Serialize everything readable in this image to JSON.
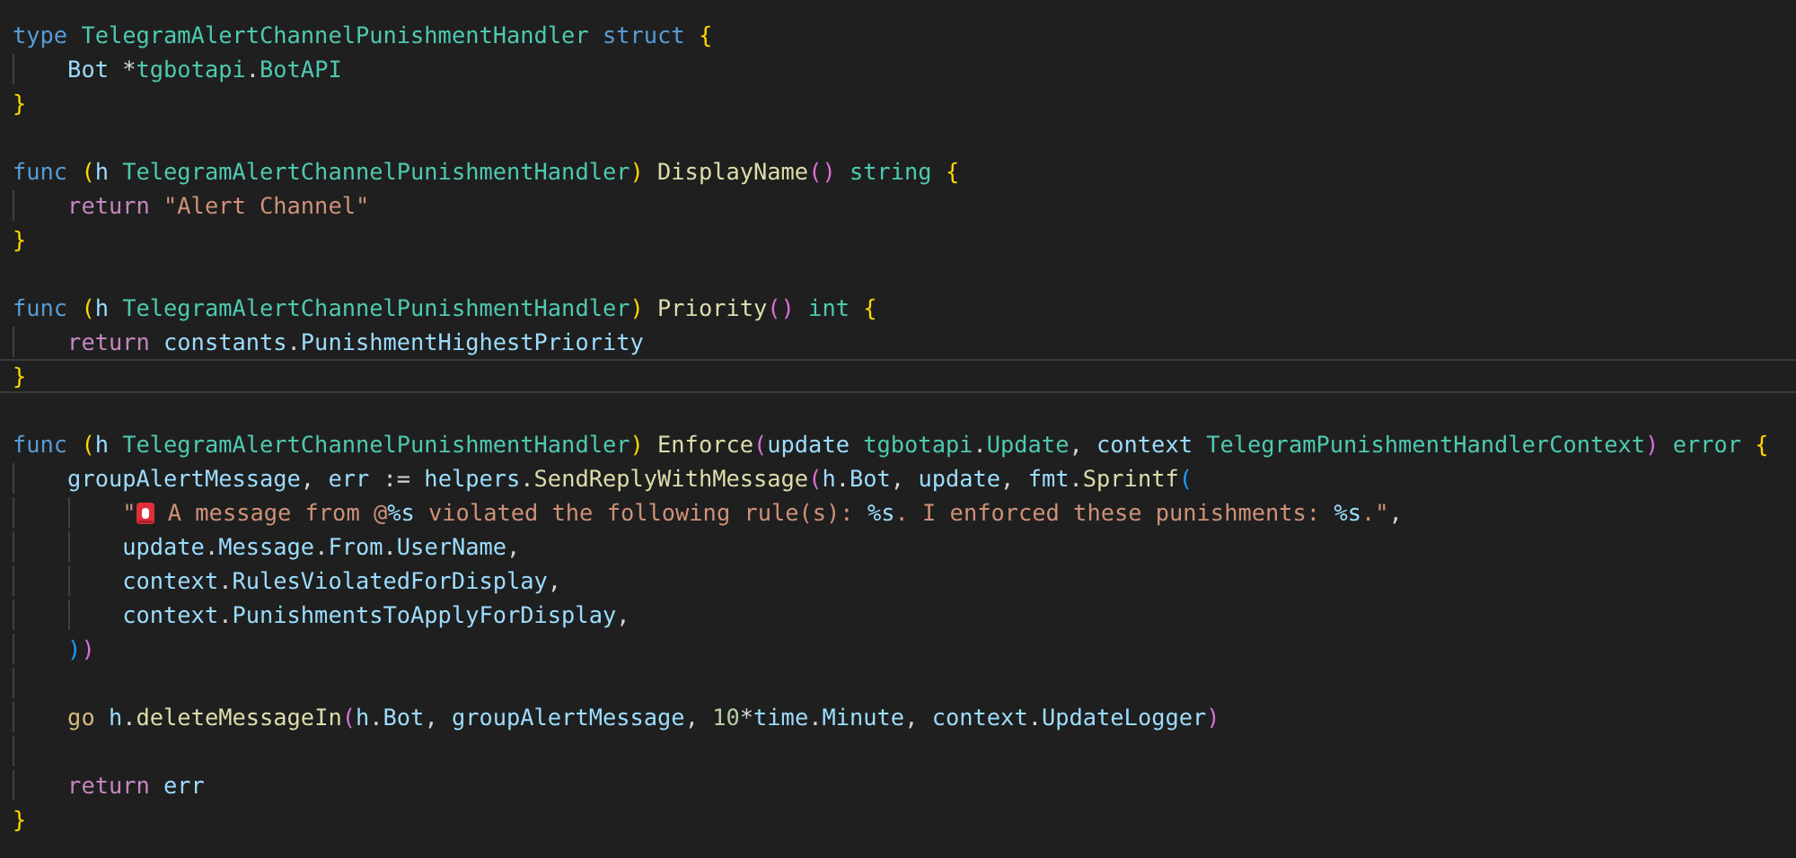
{
  "editor": {
    "lines": [
      {
        "current": false,
        "tokens": [
          {
            "text": "type",
            "kind": "kw"
          },
          {
            "text": " TelegramAlertChannelPunishmentHandler",
            "kind": "type"
          },
          {
            "text": " struct",
            "kind": "kw"
          },
          {
            "text": " {",
            "kind": "b1"
          }
        ]
      },
      {
        "current": false,
        "tokens": [
          {
            "text": "    Bot",
            "kind": "var"
          },
          {
            "text": " *",
            "kind": "plain"
          },
          {
            "text": "tgbotapi",
            "kind": "type"
          },
          {
            "text": ".",
            "kind": "plain"
          },
          {
            "text": "BotAPI",
            "kind": "type"
          }
        ]
      },
      {
        "current": false,
        "tokens": [
          {
            "text": "}",
            "kind": "b1"
          }
        ]
      },
      {
        "current": false
      },
      {
        "current": false,
        "tokens": [
          {
            "text": "func",
            "kind": "kw"
          },
          {
            "text": " (",
            "kind": "b1"
          },
          {
            "text": "h",
            "kind": "var"
          },
          {
            "text": " TelegramAlertChannelPunishmentHandler",
            "kind": "type"
          },
          {
            "text": ")",
            "kind": "b1"
          },
          {
            "text": " DisplayName",
            "kind": "fn"
          },
          {
            "text": "()",
            "kind": "b2"
          },
          {
            "text": " string",
            "kind": "type"
          },
          {
            "text": " {",
            "kind": "b1"
          }
        ]
      },
      {
        "current": false,
        "tokens": [
          {
            "text": "    return",
            "kind": "ctrl"
          },
          {
            "text": " \"Alert Channel\"",
            "kind": "str"
          }
        ]
      },
      {
        "current": false,
        "tokens": [
          {
            "text": "}",
            "kind": "b1"
          }
        ]
      },
      {
        "current": false
      },
      {
        "current": false,
        "tokens": [
          {
            "text": "func",
            "kind": "kw"
          },
          {
            "text": " (",
            "kind": "b1"
          },
          {
            "text": "h",
            "kind": "var"
          },
          {
            "text": " TelegramAlertChannelPunishmentHandler",
            "kind": "type"
          },
          {
            "text": ")",
            "kind": "b1"
          },
          {
            "text": " Priority",
            "kind": "fn"
          },
          {
            "text": "()",
            "kind": "b2"
          },
          {
            "text": " int",
            "kind": "type"
          },
          {
            "text": " {",
            "kind": "b1"
          }
        ]
      },
      {
        "current": false,
        "tokens": [
          {
            "text": "    return",
            "kind": "ctrl"
          },
          {
            "text": " constants",
            "kind": "var"
          },
          {
            "text": ".",
            "kind": "plain"
          },
          {
            "text": "PunishmentHighestPriority",
            "kind": "var"
          }
        ]
      },
      {
        "current": true,
        "tokens": [
          {
            "text": "}",
            "kind": "b1"
          }
        ]
      },
      {
        "current": false
      },
      {
        "current": false,
        "tokens": [
          {
            "text": "func",
            "kind": "kw"
          },
          {
            "text": " (",
            "kind": "b1"
          },
          {
            "text": "h",
            "kind": "var"
          },
          {
            "text": " TelegramAlertChannelPunishmentHandler",
            "kind": "type"
          },
          {
            "text": ")",
            "kind": "b1"
          },
          {
            "text": " Enforce",
            "kind": "fn"
          },
          {
            "text": "(",
            "kind": "b2"
          },
          {
            "text": "update",
            "kind": "var"
          },
          {
            "text": " tgbotapi",
            "kind": "type"
          },
          {
            "text": ".",
            "kind": "plain"
          },
          {
            "text": "Update",
            "kind": "type"
          },
          {
            "text": ",",
            "kind": "plain"
          },
          {
            "text": " context",
            "kind": "var"
          },
          {
            "text": " TelegramPunishmentHandlerContext",
            "kind": "type"
          },
          {
            "text": ")",
            "kind": "b2"
          },
          {
            "text": " error",
            "kind": "type"
          },
          {
            "text": " {",
            "kind": "b1"
          }
        ]
      },
      {
        "current": false,
        "tokens": [
          {
            "text": "    groupAlertMessage",
            "kind": "var"
          },
          {
            "text": ",",
            "kind": "plain"
          },
          {
            "text": " err",
            "kind": "var"
          },
          {
            "text": " :=",
            "kind": "plain"
          },
          {
            "text": " helpers",
            "kind": "var"
          },
          {
            "text": ".",
            "kind": "plain"
          },
          {
            "text": "SendReplyWithMessage",
            "kind": "fn"
          },
          {
            "text": "(",
            "kind": "b2"
          },
          {
            "text": "h",
            "kind": "var"
          },
          {
            "text": ".",
            "kind": "plain"
          },
          {
            "text": "Bot",
            "kind": "var"
          },
          {
            "text": ",",
            "kind": "plain"
          },
          {
            "text": " update",
            "kind": "var"
          },
          {
            "text": ",",
            "kind": "plain"
          },
          {
            "text": " fmt",
            "kind": "var"
          },
          {
            "text": ".",
            "kind": "plain"
          },
          {
            "text": "Sprintf",
            "kind": "fn"
          },
          {
            "text": "(",
            "kind": "b3"
          }
        ]
      },
      {
        "current": false,
        "tokens": [
          {
            "text": "        \"",
            "kind": "str"
          },
          {
            "kind": "siren"
          },
          {
            "text": " A message from @",
            "kind": "str"
          },
          {
            "text": "%s",
            "kind": "fmt"
          },
          {
            "text": " violated the following rule(s): ",
            "kind": "str"
          },
          {
            "text": "%s",
            "kind": "fmt"
          },
          {
            "text": ". I enforced these punishments: ",
            "kind": "str"
          },
          {
            "text": "%s",
            "kind": "fmt"
          },
          {
            "text": ".\"",
            "kind": "str"
          },
          {
            "text": ",",
            "kind": "plain"
          }
        ]
      },
      {
        "current": false,
        "tokens": [
          {
            "text": "        update",
            "kind": "var"
          },
          {
            "text": ".",
            "kind": "plain"
          },
          {
            "text": "Message",
            "kind": "var"
          },
          {
            "text": ".",
            "kind": "plain"
          },
          {
            "text": "From",
            "kind": "var"
          },
          {
            "text": ".",
            "kind": "plain"
          },
          {
            "text": "UserName",
            "kind": "var"
          },
          {
            "text": ",",
            "kind": "plain"
          }
        ]
      },
      {
        "current": false,
        "tokens": [
          {
            "text": "        context",
            "kind": "var"
          },
          {
            "text": ".",
            "kind": "plain"
          },
          {
            "text": "RulesViolatedForDisplay",
            "kind": "var"
          },
          {
            "text": ",",
            "kind": "plain"
          }
        ]
      },
      {
        "current": false,
        "tokens": [
          {
            "text": "        context",
            "kind": "var"
          },
          {
            "text": ".",
            "kind": "plain"
          },
          {
            "text": "PunishmentsToApplyForDisplay",
            "kind": "var"
          },
          {
            "text": ",",
            "kind": "plain"
          }
        ]
      },
      {
        "current": false,
        "tokens": [
          {
            "text": "    )",
            "kind": "b3"
          },
          {
            "text": ")",
            "kind": "b2"
          }
        ]
      },
      {
        "current": false
      },
      {
        "current": false,
        "tokens": [
          {
            "text": "    go",
            "kind": "go"
          },
          {
            "text": " h",
            "kind": "var"
          },
          {
            "text": ".",
            "kind": "plain"
          },
          {
            "text": "deleteMessageIn",
            "kind": "fn"
          },
          {
            "text": "(",
            "kind": "b2"
          },
          {
            "text": "h",
            "kind": "var"
          },
          {
            "text": ".",
            "kind": "plain"
          },
          {
            "text": "Bot",
            "kind": "var"
          },
          {
            "text": ",",
            "kind": "plain"
          },
          {
            "text": " groupAlertMessage",
            "kind": "var"
          },
          {
            "text": ",",
            "kind": "plain"
          },
          {
            "text": " 10",
            "kind": "num"
          },
          {
            "text": "*",
            "kind": "plain"
          },
          {
            "text": "time",
            "kind": "var"
          },
          {
            "text": ".",
            "kind": "plain"
          },
          {
            "text": "Minute",
            "kind": "var"
          },
          {
            "text": ",",
            "kind": "plain"
          },
          {
            "text": " context",
            "kind": "var"
          },
          {
            "text": ".",
            "kind": "plain"
          },
          {
            "text": "UpdateLogger",
            "kind": "var"
          },
          {
            "text": ")",
            "kind": "b2"
          }
        ]
      },
      {
        "current": false
      },
      {
        "current": false,
        "tokens": [
          {
            "text": "    return",
            "kind": "ctrl"
          },
          {
            "text": " err",
            "kind": "var"
          }
        ]
      },
      {
        "current": false,
        "tokens": [
          {
            "text": "}",
            "kind": "b1"
          }
        ]
      }
    ]
  }
}
